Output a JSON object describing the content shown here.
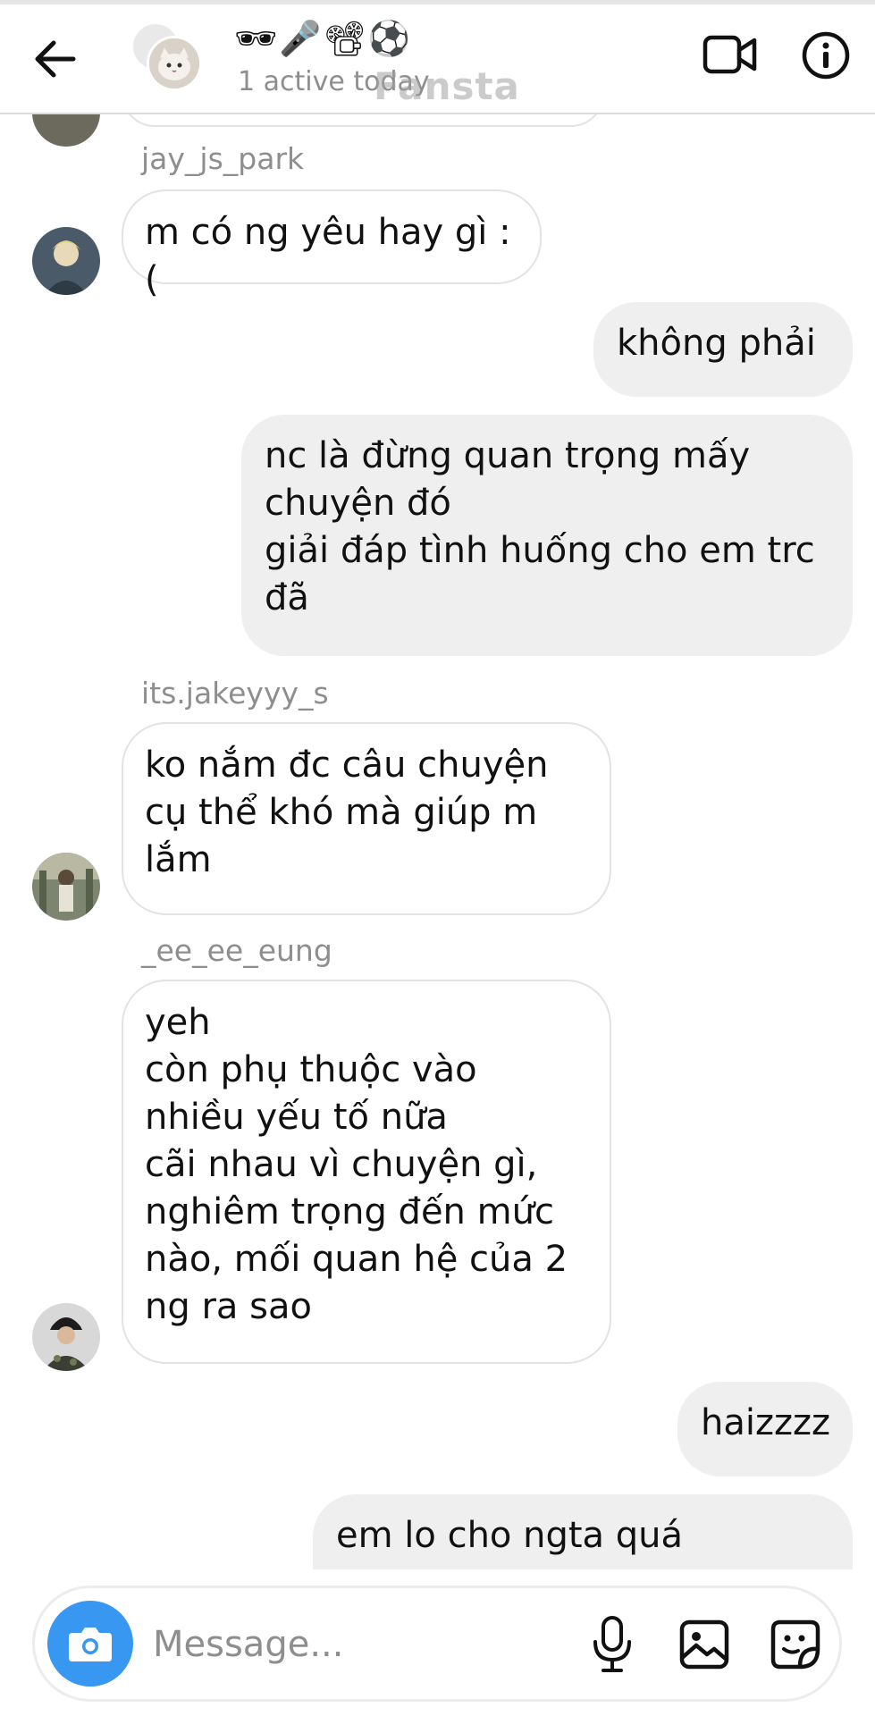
{
  "header": {
    "title": "🕶🎤📽⚽",
    "subtitle": "1 active today",
    "watermark": "Fansta"
  },
  "messages": [
    {
      "sender": "jay_js_park",
      "text": "m có ng yêu hay gì :("
    },
    {
      "text": "không phải"
    },
    {
      "text": "nc là đừng quan trọng mấy\nchuyện đó\ngiải đáp tình huống cho em trc\nđã"
    },
    {
      "sender": "its.jakeyyy_s",
      "text": "ko nắm đc câu chuyện\ncụ thể khó mà giúp m\nlắm"
    },
    {
      "sender": "_ee_ee_eung",
      "text": "yeh\ncòn phụ thuộc vào\nnhiều yếu tố nữa\ncãi nhau vì chuyện gì,\nnghiêm trọng đến mức\nnào, mối quan hệ của 2\nng ra sao"
    },
    {
      "text": "haizzzz"
    },
    {
      "text": "em lo cho ngta quá"
    }
  ],
  "composer": {
    "placeholder": "Message..."
  },
  "icons": {
    "back": "arrow-left-icon",
    "video": "video-camera-icon",
    "info": "info-icon",
    "camera": "camera-icon",
    "mic": "microphone-icon",
    "gallery": "image-icon",
    "sticker": "sticker-icon"
  },
  "colors": {
    "accent": "#3897f0",
    "incoming_border": "#e3e3e3",
    "outgoing_bg": "#efefef",
    "meta_text": "#8e8e8e"
  }
}
